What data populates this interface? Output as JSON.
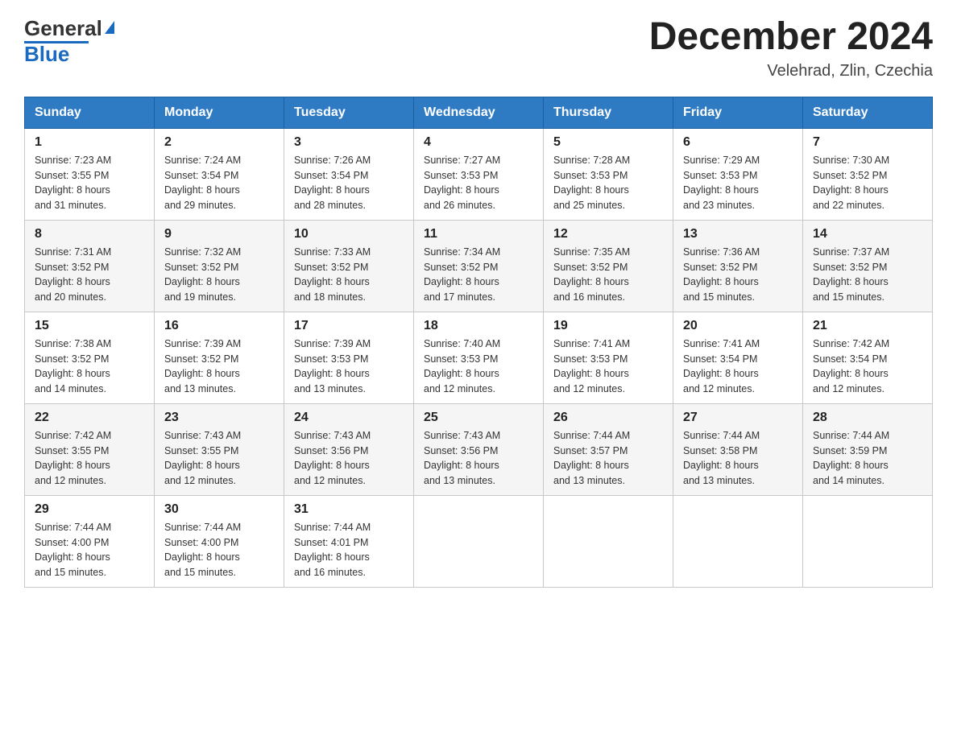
{
  "header": {
    "logo": {
      "general": "General",
      "blue": "Blue",
      "tagline": ""
    },
    "title": "December 2024",
    "location": "Velehrad, Zlin, Czechia"
  },
  "weekdays": [
    "Sunday",
    "Monday",
    "Tuesday",
    "Wednesday",
    "Thursday",
    "Friday",
    "Saturday"
  ],
  "weeks": [
    [
      {
        "day": "1",
        "sunrise": "7:23 AM",
        "sunset": "3:55 PM",
        "daylight": "8 hours and 31 minutes."
      },
      {
        "day": "2",
        "sunrise": "7:24 AM",
        "sunset": "3:54 PM",
        "daylight": "8 hours and 29 minutes."
      },
      {
        "day": "3",
        "sunrise": "7:26 AM",
        "sunset": "3:54 PM",
        "daylight": "8 hours and 28 minutes."
      },
      {
        "day": "4",
        "sunrise": "7:27 AM",
        "sunset": "3:53 PM",
        "daylight": "8 hours and 26 minutes."
      },
      {
        "day": "5",
        "sunrise": "7:28 AM",
        "sunset": "3:53 PM",
        "daylight": "8 hours and 25 minutes."
      },
      {
        "day": "6",
        "sunrise": "7:29 AM",
        "sunset": "3:53 PM",
        "daylight": "8 hours and 23 minutes."
      },
      {
        "day": "7",
        "sunrise": "7:30 AM",
        "sunset": "3:52 PM",
        "daylight": "8 hours and 22 minutes."
      }
    ],
    [
      {
        "day": "8",
        "sunrise": "7:31 AM",
        "sunset": "3:52 PM",
        "daylight": "8 hours and 20 minutes."
      },
      {
        "day": "9",
        "sunrise": "7:32 AM",
        "sunset": "3:52 PM",
        "daylight": "8 hours and 19 minutes."
      },
      {
        "day": "10",
        "sunrise": "7:33 AM",
        "sunset": "3:52 PM",
        "daylight": "8 hours and 18 minutes."
      },
      {
        "day": "11",
        "sunrise": "7:34 AM",
        "sunset": "3:52 PM",
        "daylight": "8 hours and 17 minutes."
      },
      {
        "day": "12",
        "sunrise": "7:35 AM",
        "sunset": "3:52 PM",
        "daylight": "8 hours and 16 minutes."
      },
      {
        "day": "13",
        "sunrise": "7:36 AM",
        "sunset": "3:52 PM",
        "daylight": "8 hours and 15 minutes."
      },
      {
        "day": "14",
        "sunrise": "7:37 AM",
        "sunset": "3:52 PM",
        "daylight": "8 hours and 15 minutes."
      }
    ],
    [
      {
        "day": "15",
        "sunrise": "7:38 AM",
        "sunset": "3:52 PM",
        "daylight": "8 hours and 14 minutes."
      },
      {
        "day": "16",
        "sunrise": "7:39 AM",
        "sunset": "3:52 PM",
        "daylight": "8 hours and 13 minutes."
      },
      {
        "day": "17",
        "sunrise": "7:39 AM",
        "sunset": "3:53 PM",
        "daylight": "8 hours and 13 minutes."
      },
      {
        "day": "18",
        "sunrise": "7:40 AM",
        "sunset": "3:53 PM",
        "daylight": "8 hours and 12 minutes."
      },
      {
        "day": "19",
        "sunrise": "7:41 AM",
        "sunset": "3:53 PM",
        "daylight": "8 hours and 12 minutes."
      },
      {
        "day": "20",
        "sunrise": "7:41 AM",
        "sunset": "3:54 PM",
        "daylight": "8 hours and 12 minutes."
      },
      {
        "day": "21",
        "sunrise": "7:42 AM",
        "sunset": "3:54 PM",
        "daylight": "8 hours and 12 minutes."
      }
    ],
    [
      {
        "day": "22",
        "sunrise": "7:42 AM",
        "sunset": "3:55 PM",
        "daylight": "8 hours and 12 minutes."
      },
      {
        "day": "23",
        "sunrise": "7:43 AM",
        "sunset": "3:55 PM",
        "daylight": "8 hours and 12 minutes."
      },
      {
        "day": "24",
        "sunrise": "7:43 AM",
        "sunset": "3:56 PM",
        "daylight": "8 hours and 12 minutes."
      },
      {
        "day": "25",
        "sunrise": "7:43 AM",
        "sunset": "3:56 PM",
        "daylight": "8 hours and 13 minutes."
      },
      {
        "day": "26",
        "sunrise": "7:44 AM",
        "sunset": "3:57 PM",
        "daylight": "8 hours and 13 minutes."
      },
      {
        "day": "27",
        "sunrise": "7:44 AM",
        "sunset": "3:58 PM",
        "daylight": "8 hours and 13 minutes."
      },
      {
        "day": "28",
        "sunrise": "7:44 AM",
        "sunset": "3:59 PM",
        "daylight": "8 hours and 14 minutes."
      }
    ],
    [
      {
        "day": "29",
        "sunrise": "7:44 AM",
        "sunset": "4:00 PM",
        "daylight": "8 hours and 15 minutes."
      },
      {
        "day": "30",
        "sunrise": "7:44 AM",
        "sunset": "4:00 PM",
        "daylight": "8 hours and 15 minutes."
      },
      {
        "day": "31",
        "sunrise": "7:44 AM",
        "sunset": "4:01 PM",
        "daylight": "8 hours and 16 minutes."
      },
      null,
      null,
      null,
      null
    ]
  ],
  "labels": {
    "sunrise": "Sunrise:",
    "sunset": "Sunset:",
    "daylight": "Daylight:"
  }
}
